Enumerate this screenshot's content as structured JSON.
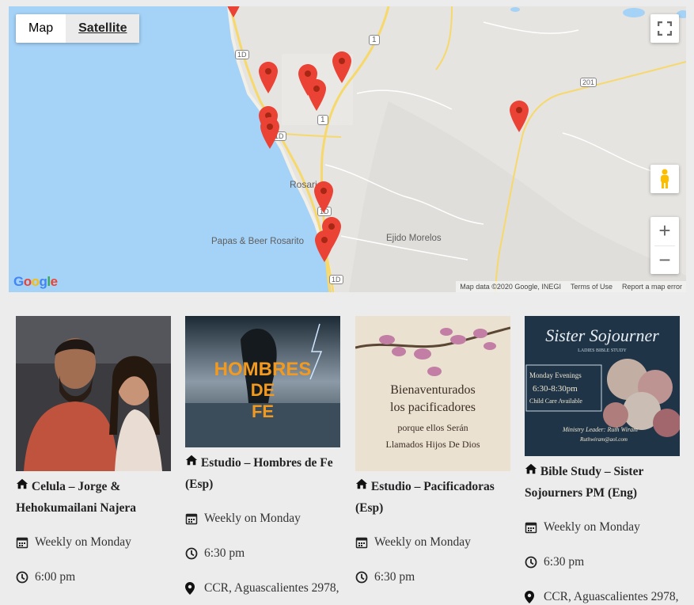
{
  "map": {
    "type_buttons": {
      "map": "Map",
      "satellite": "Satellite"
    },
    "labels": {
      "city": "Rosari",
      "place": "Papas & Beer Rosarito",
      "ejido": "Ejido Morelos",
      "hw1a": "1",
      "hw1b": "1",
      "hw1d_a": "1D",
      "hw1d_b": "1D",
      "hw1d_c": "1D",
      "hw1d_d": "1D",
      "hw201": "201"
    },
    "footer": {
      "data": "Map data ©2020 Google, INEGI",
      "terms": "Terms of Use",
      "report": "Report a map error"
    },
    "logo": "Google",
    "zoom_in": "+",
    "zoom_out": "−",
    "colors": {
      "water": "#a5d2f7",
      "land": "#e4e3df",
      "highway": "#f7d86a",
      "pin": "#ea4335"
    }
  },
  "events": [
    {
      "title": "Celula – Jorge & Hehokumailani Najera",
      "schedule": "Weekly on Monday",
      "time": "6:00 pm",
      "image": "couple-photo"
    },
    {
      "title": "Estudio – Hombres de Fe (Esp)",
      "schedule": "Weekly on Monday",
      "time": "6:30 pm",
      "location": "CCR, Aguascalientes 2978,",
      "image_text": [
        "HOMBRES",
        "DE",
        "FE"
      ]
    },
    {
      "title": "Estudio – Pacificadoras (Esp)",
      "schedule": "Weekly on Monday",
      "time": "6:30 pm",
      "image_text": [
        "Bienaventurados",
        "los pacificadores",
        "porque ellos Serán",
        "Llamados Hijos De Dios"
      ]
    },
    {
      "title": "Bible Study – Sister Sojourners PM (Eng)",
      "schedule": "Weekly on Monday",
      "time": "6:30 pm",
      "location": "CCR, Aguascalientes 2978,",
      "image_text": {
        "heading": "Sister Sojourner",
        "sub": "LADIES BIBLE STUDY",
        "line1": "Monday Evenings",
        "line2": "6:30-8:30pm",
        "line3": "Child Care Available",
        "leader": "Ministry Leader: Ruth Wiram",
        "email": "Ruthwiram@aol.com"
      }
    }
  ]
}
